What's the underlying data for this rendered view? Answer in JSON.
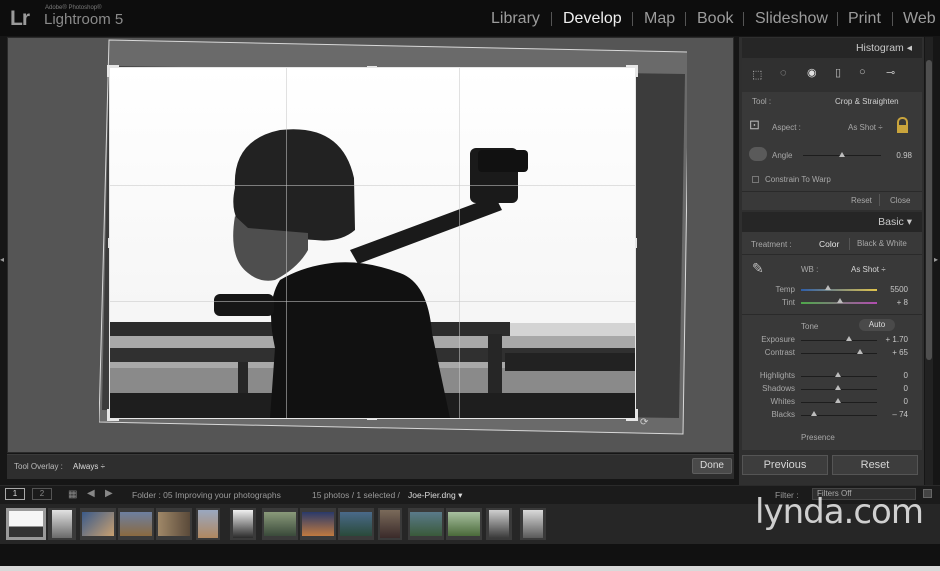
{
  "app": {
    "logo": "Lr",
    "vendor": "Adobe® Photoshop®",
    "name": "Lightroom 5"
  },
  "modules": [
    "Library",
    "Develop",
    "Map",
    "Book",
    "Slideshow",
    "Print",
    "Web"
  ],
  "active_module": "Develop",
  "toolbar": {
    "overlay_label": "Tool Overlay :",
    "overlay_value": "Always ÷",
    "done_label": "Done"
  },
  "histogram": {
    "title": "Histogram ◂"
  },
  "crop_tool": {
    "tool_label": "Tool :",
    "tool_value": "Crop & Straighten",
    "aspect_label": "Aspect :",
    "aspect_value": "As Shot ÷",
    "angle_label": "Angle",
    "angle_value": "0.98",
    "constrain_label": "Constrain To Warp",
    "reset_label": "Reset",
    "close_label": "Close"
  },
  "basic": {
    "title": "Basic ▾",
    "treatment_label": "Treatment :",
    "treatment_color": "Color",
    "treatment_bw": "Black & White",
    "wb_label": "WB :",
    "wb_value": "As Shot ÷",
    "temp_label": "Temp",
    "temp_value": "5500",
    "tint_label": "Tint",
    "tint_value": "+ 8",
    "tone_label": "Tone",
    "auto_label": "Auto",
    "exposure_label": "Exposure",
    "exposure_value": "+ 1.70",
    "contrast_label": "Contrast",
    "contrast_value": "+ 65",
    "highlights_label": "Highlights",
    "highlights_value": "0",
    "shadows_label": "Shadows",
    "shadows_value": "0",
    "whites_label": "Whites",
    "whites_value": "0",
    "blacks_label": "Blacks",
    "blacks_value": "– 74",
    "presence_label": "Presence"
  },
  "buttons": {
    "previous": "Previous",
    "reset": "Reset"
  },
  "filmbar": {
    "view1": "1",
    "view2": "2",
    "folder": "Folder : 05 Improving your photographs",
    "count": "15 photos / 1 selected /",
    "filename": "Joe-Pier.dng ▾",
    "filter_label": "Filter :",
    "filter_value": "Filters Off"
  },
  "watermark": "lynda.com"
}
